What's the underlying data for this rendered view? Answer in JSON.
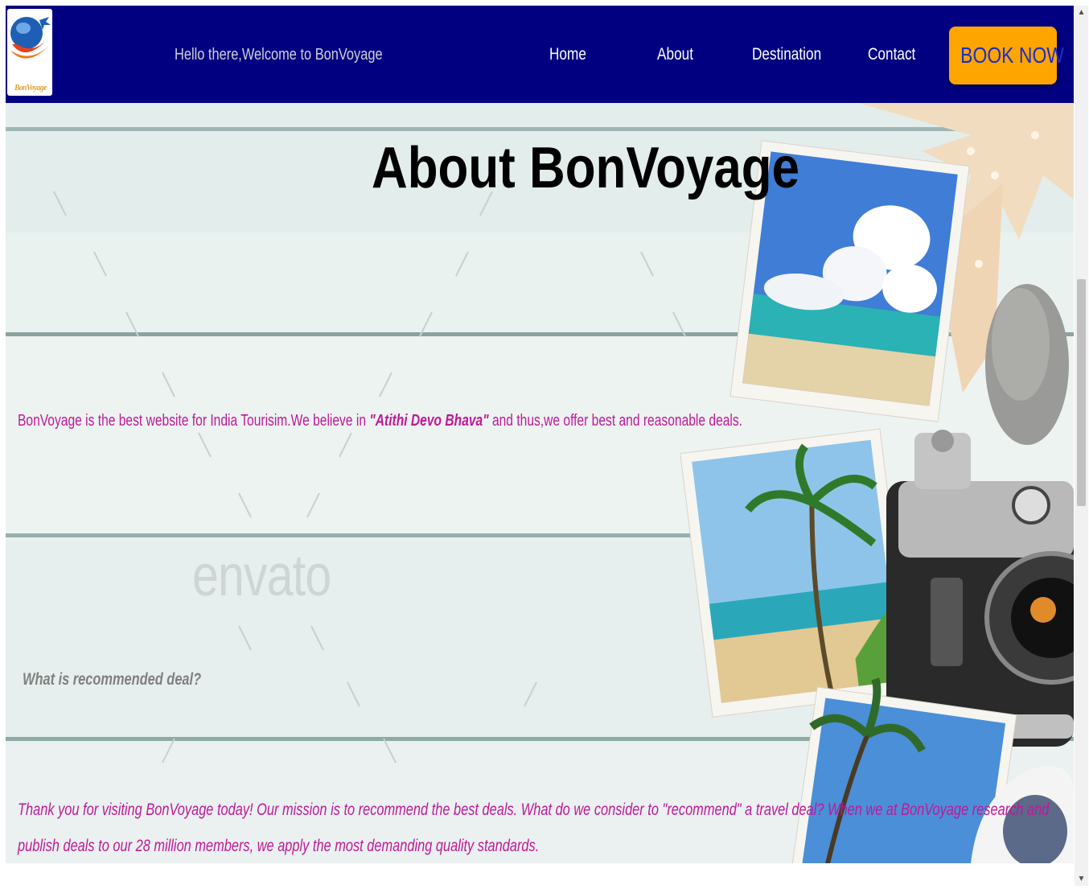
{
  "navbar": {
    "logo_text": "BonVoyage",
    "welcome": "Hello there,Welcome to BonVoyage",
    "links": [
      "Home",
      "About",
      "Destination",
      "Contact"
    ],
    "book_button": "BOOK NOW",
    "background_color": "#000080",
    "button_color": "#ffa500"
  },
  "hero": {
    "title": "About BonVoyage",
    "intro_before": "BonVoyage is the best website for India Tourisim.We believe in ",
    "intro_emphasis": "\"Atithi Devo Bhava\"",
    "intro_after": " and thus,we offer best and reasonable deals.",
    "watermark": "envato",
    "question": "What is recommended deal?",
    "mission": "Thank you for visiting BonVoyage today! Our mission is to recommend the best deals. What do we consider to \"recommend\" a travel deal? When we at BonVoyage research and publish deals to our 28 million members, we apply the most demanding quality standards.",
    "text_color": "#c0189a"
  },
  "scrollbar": {
    "up_arrow": "▲",
    "down_arrow": "▼"
  }
}
